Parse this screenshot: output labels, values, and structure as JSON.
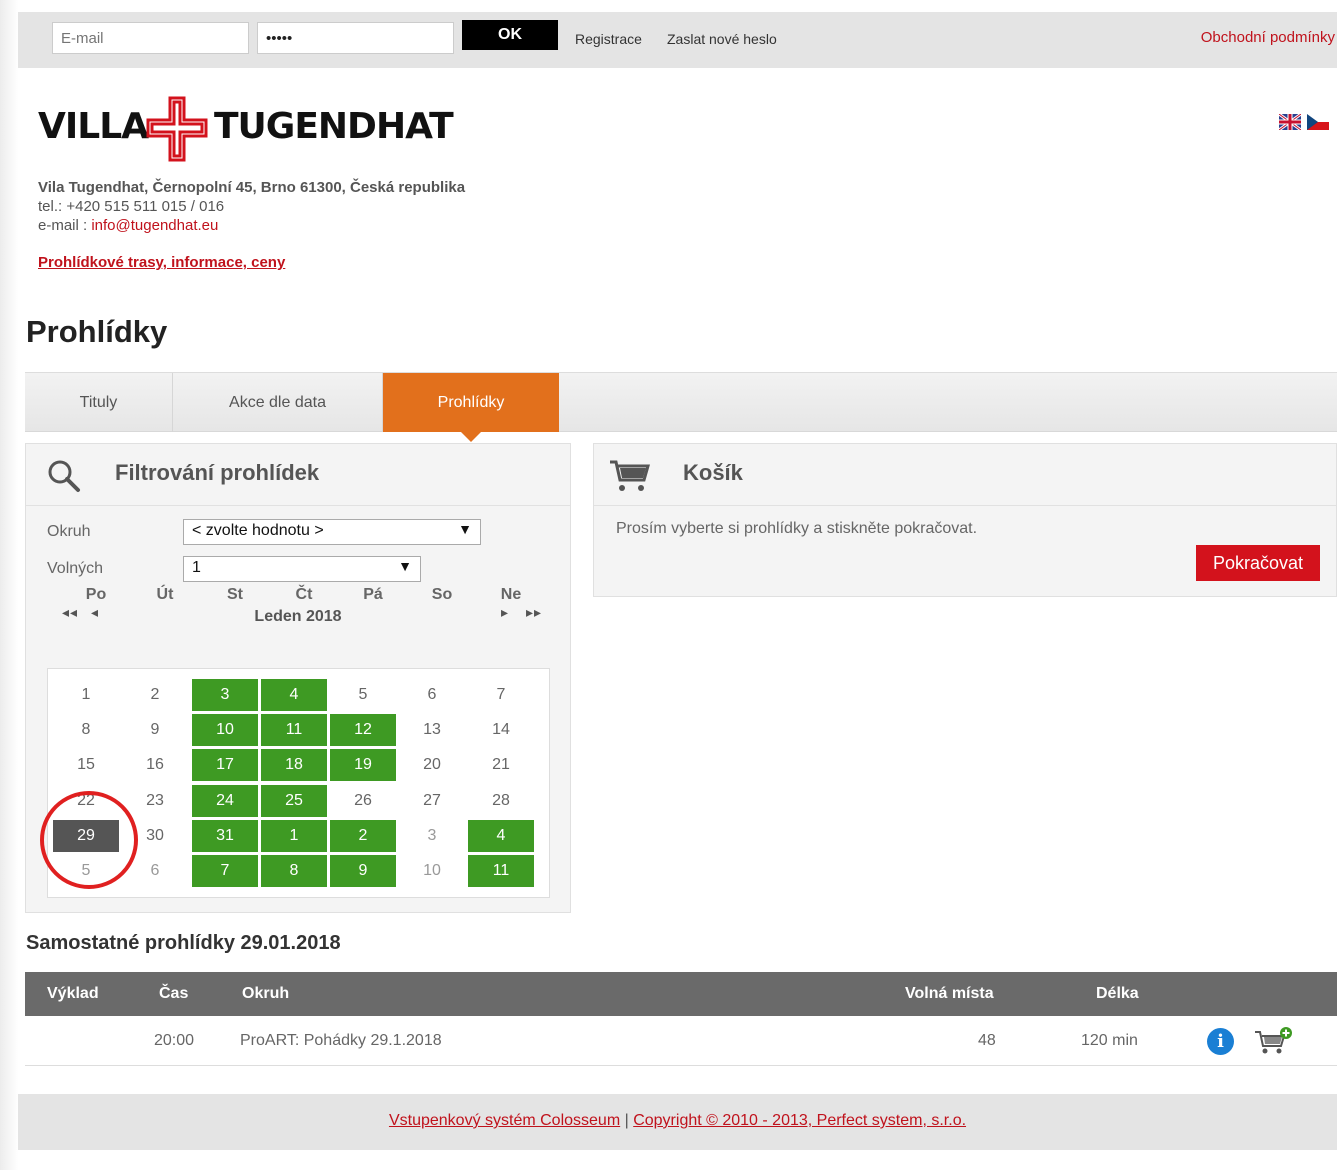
{
  "topbar": {
    "email_placeholder": "E-mail",
    "password_value": "•••••",
    "ok_label": "OK",
    "register_label": "Registrace",
    "new_password_label": "Zaslat nové heslo",
    "terms_label": "Obchodní podmínky"
  },
  "header": {
    "logo_left": "VILLA",
    "logo_right": "TUGENDHAT",
    "address_line": "Vila Tugendhat, Černopolní 45, Brno 61300, Česká republika",
    "phone_line": "tel.: +420 515 511 015 / 016",
    "email_prefix": "e-mail : ",
    "email": "info@tugendhat.eu",
    "tours_link": "Prohlídkové trasy, informace, ceny",
    "flags": [
      "gb-flag-icon",
      "cz-flag-icon"
    ]
  },
  "page_title": "Prohlídky",
  "tabs": [
    {
      "label": "Tituly",
      "active": false
    },
    {
      "label": "Akce dle data",
      "active": false
    },
    {
      "label": "Prohlídky",
      "active": true
    }
  ],
  "filter": {
    "title": "Filtrování prohlídek",
    "okruh_label": "Okruh",
    "okruh_value": "< zvolte hodnotu >",
    "volnych_label": "Volných",
    "volnych_value": "1",
    "month": "Leden 2018",
    "prev_year": "◂◂",
    "prev_month": "◂",
    "next_month": "▸",
    "next_year": "▸▸",
    "weekdays": [
      "Po",
      "Út",
      "St",
      "Čt",
      "Pá",
      "So",
      "Ne"
    ],
    "weeks": [
      [
        {
          "d": "1",
          "s": ""
        },
        {
          "d": "2",
          "s": ""
        },
        {
          "d": "3",
          "s": "avail"
        },
        {
          "d": "4",
          "s": "avail"
        },
        {
          "d": "5",
          "s": ""
        },
        {
          "d": "6",
          "s": ""
        },
        {
          "d": "7",
          "s": ""
        }
      ],
      [
        {
          "d": "8",
          "s": ""
        },
        {
          "d": "9",
          "s": ""
        },
        {
          "d": "10",
          "s": "avail"
        },
        {
          "d": "11",
          "s": "avail"
        },
        {
          "d": "12",
          "s": "avail"
        },
        {
          "d": "13",
          "s": ""
        },
        {
          "d": "14",
          "s": ""
        }
      ],
      [
        {
          "d": "15",
          "s": ""
        },
        {
          "d": "16",
          "s": ""
        },
        {
          "d": "17",
          "s": "avail"
        },
        {
          "d": "18",
          "s": "avail"
        },
        {
          "d": "19",
          "s": "avail"
        },
        {
          "d": "20",
          "s": ""
        },
        {
          "d": "21",
          "s": ""
        }
      ],
      [
        {
          "d": "22",
          "s": ""
        },
        {
          "d": "23",
          "s": ""
        },
        {
          "d": "24",
          "s": "avail"
        },
        {
          "d": "25",
          "s": "avail"
        },
        {
          "d": "26",
          "s": ""
        },
        {
          "d": "27",
          "s": ""
        },
        {
          "d": "28",
          "s": ""
        }
      ],
      [
        {
          "d": "29",
          "s": "sel"
        },
        {
          "d": "30",
          "s": ""
        },
        {
          "d": "31",
          "s": "avail"
        },
        {
          "d": "1",
          "s": "avail"
        },
        {
          "d": "2",
          "s": "avail"
        },
        {
          "d": "3",
          "s": "other"
        },
        {
          "d": "4",
          "s": "avail"
        }
      ],
      [
        {
          "d": "5",
          "s": "other"
        },
        {
          "d": "6",
          "s": "other"
        },
        {
          "d": "7",
          "s": "avail"
        },
        {
          "d": "8",
          "s": "avail"
        },
        {
          "d": "9",
          "s": "avail"
        },
        {
          "d": "10",
          "s": "other"
        },
        {
          "d": "11",
          "s": "avail"
        }
      ]
    ]
  },
  "basket": {
    "title": "Košík",
    "message": "Prosím vyberte si prohlídky a stiskněte pokračovat.",
    "continue_label": "Pokračovat"
  },
  "tours": {
    "title": "Samostatné prohlídky 29.01.2018",
    "headers": {
      "vyklad": "Výklad",
      "cas": "Čas",
      "okruh": "Okruh",
      "volna": "Volná místa",
      "delka": "Délka"
    },
    "rows": [
      {
        "vyklad": "",
        "cas": "20:00",
        "okruh": "ProART: Pohádky 29.1.2018",
        "volna": "48",
        "delka": "120 min"
      }
    ]
  },
  "footer": {
    "system_link": "Vstupenkový systém Colosseum",
    "separator": " | ",
    "copyright_link": "Copyright © 2010 - 2013, Perfect system, s.r.o."
  },
  "colors": {
    "accent_orange": "#e2701c",
    "available_green": "#3e9a23",
    "brand_red": "#c0121c",
    "button_red": "#d3121c"
  }
}
